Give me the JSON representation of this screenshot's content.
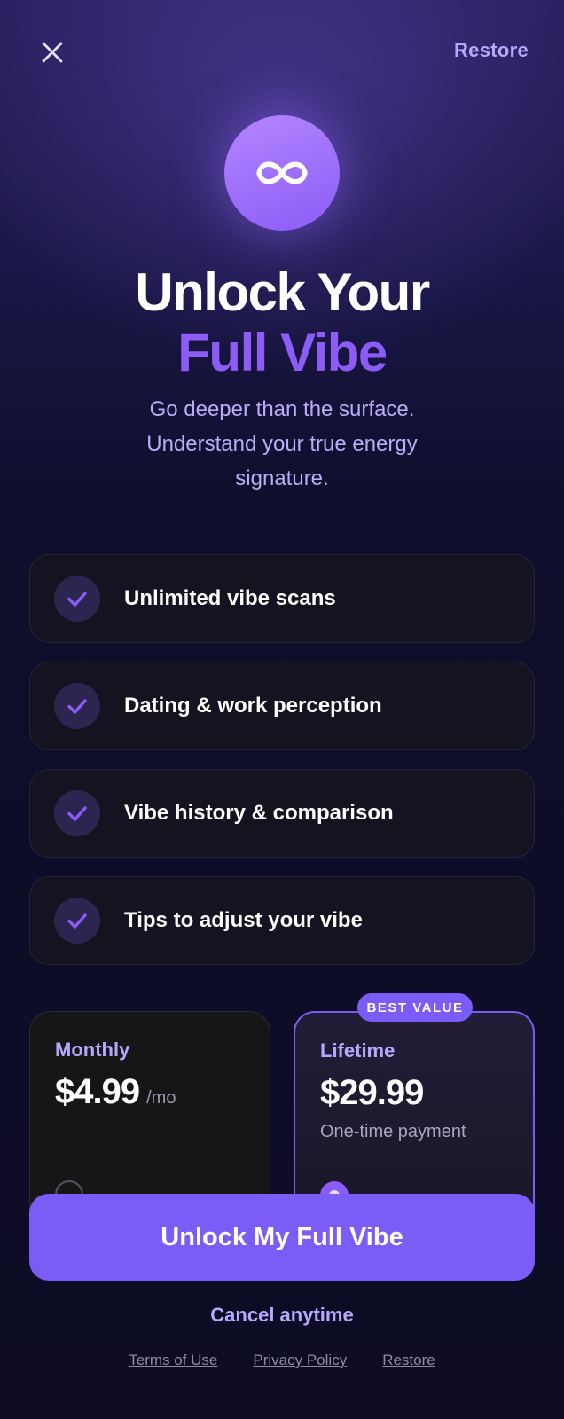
{
  "header": {
    "close_icon": "close-icon",
    "restore_label": "Restore"
  },
  "hero": {
    "logo_icon": "infinity-icon",
    "title_line1": "Unlock Your",
    "title_line2": "Full Vibe",
    "subtitle": "Go deeper than the surface. Understand your true energy signature."
  },
  "features": [
    {
      "label": "Unlimited vibe scans",
      "icon": "check-icon"
    },
    {
      "label": "Dating & work perception",
      "icon": "check-icon"
    },
    {
      "label": "Vibe history & comparison",
      "icon": "check-icon"
    },
    {
      "label": "Tips to adjust your vibe",
      "icon": "check-icon"
    }
  ],
  "plans": {
    "badge": "BEST VALUE",
    "monthly": {
      "name": "Monthly",
      "price": "$4.99",
      "period": "/mo",
      "selected": false
    },
    "lifetime": {
      "name": "Lifetime",
      "price": "$29.99",
      "note": "One-time payment",
      "selected": true
    }
  },
  "cta": {
    "label": "Unlock My Full Vibe"
  },
  "cancel_text": "Cancel anytime",
  "footer": {
    "terms": "Terms of Use",
    "privacy": "Privacy Policy",
    "restore": "Restore"
  },
  "colors": {
    "accent": "#7C5CF6",
    "accent_light": "#B7A8FF",
    "background": "#0D0C24"
  }
}
